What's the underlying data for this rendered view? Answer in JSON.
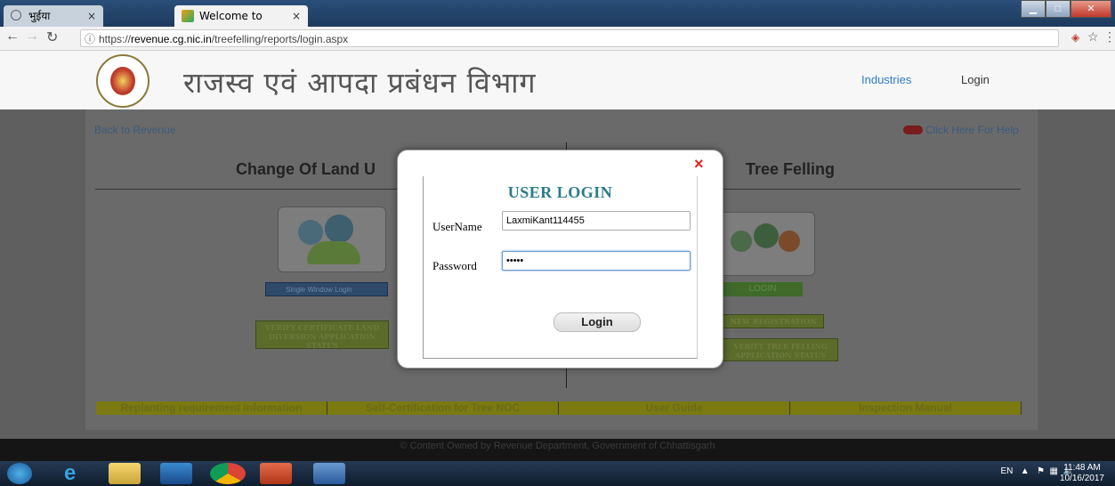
{
  "browser": {
    "tabs": [
      {
        "label": "भुईया",
        "active": false
      },
      {
        "label": "Welcome to Revenue",
        "active": true
      }
    ],
    "url_prefix": "https://",
    "url_host": "revenue.cg.nic.in",
    "url_path": "/treefelling/reports/login.aspx",
    "tab_close": "×"
  },
  "header": {
    "department": "राजस्व एवं आपदा प्रबंधन विभाग",
    "nav_industries": "Industries",
    "nav_login": "Login"
  },
  "page": {
    "back_link": "Back to Revenue",
    "help_link": "Click Here For Help",
    "heading_land": "Change Of Land U",
    "heading_tree": "Tree Felling",
    "single_window_login": "Single Window Login",
    "verify_certificate": "VERIFY CERTIFICATE LAND DIVERSION APPLICATION STATUS",
    "login_tile": "LOGIN",
    "new_registration": "NEW REGISTRATION",
    "verify_tree": "VERIFY TREE FELLING APPLICATION STATUS",
    "bottom_links": [
      "Replanting requirement information",
      "Self-Certification for Tree NOC",
      "User Guide",
      "Inspection Manual"
    ],
    "footer": "© Content Owned by Revenue Department, Government of Chhattisgarh"
  },
  "modal": {
    "title": "USER LOGIN",
    "username_label": "UserName",
    "username_value": "LaxmiKant114455",
    "password_label": "Password",
    "password_value": "•••••",
    "login_button": "Login",
    "close": "×"
  },
  "taskbar": {
    "lang": "EN",
    "time": "11:48 AM",
    "date": "10/16/2017"
  },
  "colors": {
    "accent": "#2a7b8a",
    "close": "#e0231f",
    "link": "#2e7dc6"
  }
}
